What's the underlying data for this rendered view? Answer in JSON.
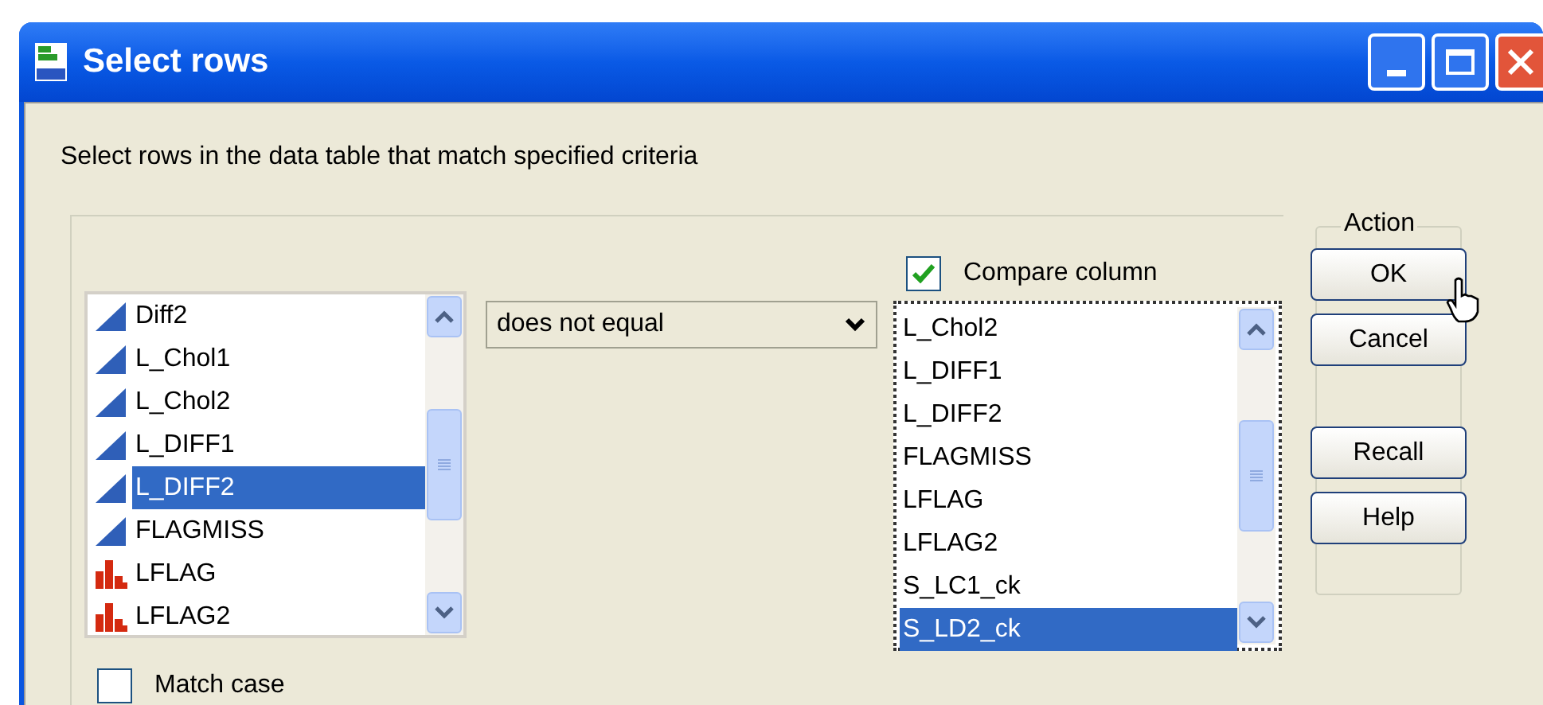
{
  "window": {
    "title": "Select rows"
  },
  "description": "Select rows in the data table that match specified criteria",
  "columns_list": [
    {
      "label": "Diff2",
      "kind": "continuous",
      "selected": false
    },
    {
      "label": "L_Chol1",
      "kind": "continuous",
      "selected": false
    },
    {
      "label": "L_Chol2",
      "kind": "continuous",
      "selected": false
    },
    {
      "label": "L_DIFF1",
      "kind": "continuous",
      "selected": false
    },
    {
      "label": "L_DIFF2",
      "kind": "continuous",
      "selected": true
    },
    {
      "label": "FLAGMISS",
      "kind": "continuous",
      "selected": false
    },
    {
      "label": "LFLAG",
      "kind": "nominal",
      "selected": false
    },
    {
      "label": "LFLAG2",
      "kind": "nominal",
      "selected": false
    }
  ],
  "condition": {
    "value": "does not equal"
  },
  "compare_column": {
    "label": "Compare column",
    "checked": true
  },
  "compare_list": [
    {
      "label": "L_Chol2",
      "selected": false
    },
    {
      "label": "L_DIFF1",
      "selected": false
    },
    {
      "label": "L_DIFF2",
      "selected": false
    },
    {
      "label": "FLAGMISS",
      "selected": false
    },
    {
      "label": "LFLAG",
      "selected": false
    },
    {
      "label": "LFLAG2",
      "selected": false
    },
    {
      "label": "S_LC1_ck",
      "selected": false
    },
    {
      "label": "S_LD2_ck",
      "selected": true
    }
  ],
  "match_case": {
    "label": "Match case",
    "checked": false
  },
  "action": {
    "title": "Action",
    "buttons": [
      "OK",
      "Cancel",
      "Recall",
      "Help"
    ]
  }
}
